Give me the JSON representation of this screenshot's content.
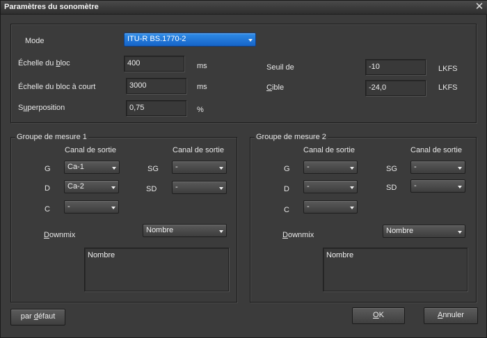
{
  "window": {
    "title": "Paramètres du sonomètre"
  },
  "top": {
    "mode_label": "Mode",
    "mode_value": "ITU-R BS.1770-2",
    "block_scale_label_pre": "Échelle du ",
    "block_scale_label_ul": "b",
    "block_scale_label_post": "loc",
    "block_scale_value": "400",
    "block_scale_unit": "ms",
    "short_block_label": "Échelle du bloc à court",
    "short_block_value": "3000",
    "short_block_unit": "ms",
    "overlap_label_pre": "S",
    "overlap_label_ul": "u",
    "overlap_label_post": "perposition",
    "overlap_value": "0,75",
    "overlap_unit": "%",
    "threshold_label": "Seuil de",
    "threshold_value": "-10",
    "threshold_unit": "LKFS",
    "target_label_ul": "C",
    "target_label_post": "ible",
    "target_value": "-24,0",
    "target_unit": "LKFS"
  },
  "groups": [
    {
      "legend": "Groupe de mesure 1",
      "col_left_header": "Canal de sortie",
      "col_right_header": "Canal de sortie",
      "rows_left": [
        {
          "label": "G",
          "value": "Ca-1"
        },
        {
          "label": "D",
          "value": "Ca-2"
        },
        {
          "label": "C",
          "value": "-"
        }
      ],
      "rows_right": [
        {
          "label": "SG",
          "value": "-"
        },
        {
          "label": "SD",
          "value": "-"
        }
      ],
      "downmix_label_ul": "D",
      "downmix_label_post": "ownmix",
      "downmix_value": "Nombre",
      "list_text": "Nombre"
    },
    {
      "legend": "Groupe de mesure 2",
      "col_left_header": "Canal de sortie",
      "col_right_header": "Canal de sortie",
      "rows_left": [
        {
          "label": "G",
          "value": "-"
        },
        {
          "label": "D",
          "value": "-"
        },
        {
          "label": "C",
          "value": "-"
        }
      ],
      "rows_right": [
        {
          "label": "SG",
          "value": "-"
        },
        {
          "label": "SD",
          "value": "-"
        }
      ],
      "downmix_label_ul": "D",
      "downmix_label_post": "ownmix",
      "downmix_value": "Nombre",
      "list_text": "Nombre"
    }
  ],
  "buttons": {
    "default_pre": "par ",
    "default_ul": "d",
    "default_post": "éfaut",
    "ok_ul": "O",
    "ok_post": "K",
    "cancel_ul": "A",
    "cancel_post": "nnuler"
  },
  "icons": {
    "close": "close-icon",
    "dropdown": "chevron-down-icon"
  }
}
